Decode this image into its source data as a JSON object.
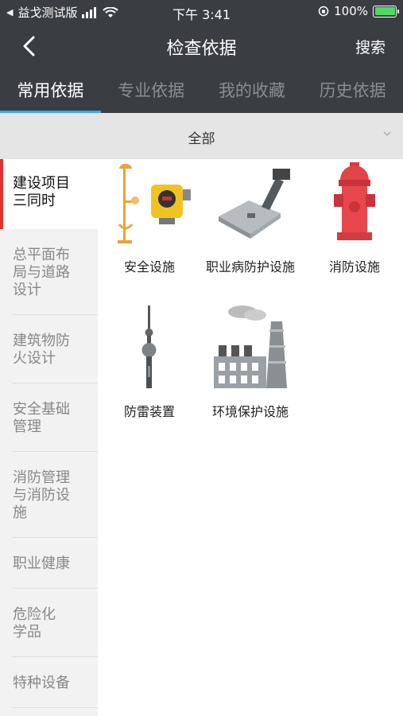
{
  "status": {
    "carrier": "益戈测试版",
    "time": "下午 3:41",
    "battery": "100%"
  },
  "nav": {
    "title": "检查依据",
    "search_label": "搜索"
  },
  "tabs": [
    {
      "label": "常用依据",
      "active": true
    },
    {
      "label": "专业依据",
      "active": false
    },
    {
      "label": "我的收藏",
      "active": false
    },
    {
      "label": "历史依据",
      "active": false
    }
  ],
  "filter": {
    "label": "全部"
  },
  "sidebar": {
    "items": [
      {
        "label": "建设项目三同时",
        "active": true
      },
      {
        "label": "总平面布局与道路设计"
      },
      {
        "label": "建筑物防火设计"
      },
      {
        "label": "安全基础管理"
      },
      {
        "label": "消防管理与消防设施"
      },
      {
        "label": "职业健康"
      },
      {
        "label": "危险化学品"
      },
      {
        "label": "特种设备"
      }
    ]
  },
  "grid": {
    "items": [
      {
        "label": "安全设施",
        "icon": "safety-facility-icon"
      },
      {
        "label": "职业病防护设施",
        "icon": "occupational-protection-icon"
      },
      {
        "label": "消防设施",
        "icon": "fire-hydrant-icon"
      },
      {
        "label": "防雷装置",
        "icon": "lightning-rod-icon"
      },
      {
        "label": "环境保护设施",
        "icon": "factory-icon"
      }
    ]
  },
  "colors": {
    "header": "#3a3d42",
    "tab_indicator": "#3aa7e6",
    "active_marker": "#e4322c"
  }
}
